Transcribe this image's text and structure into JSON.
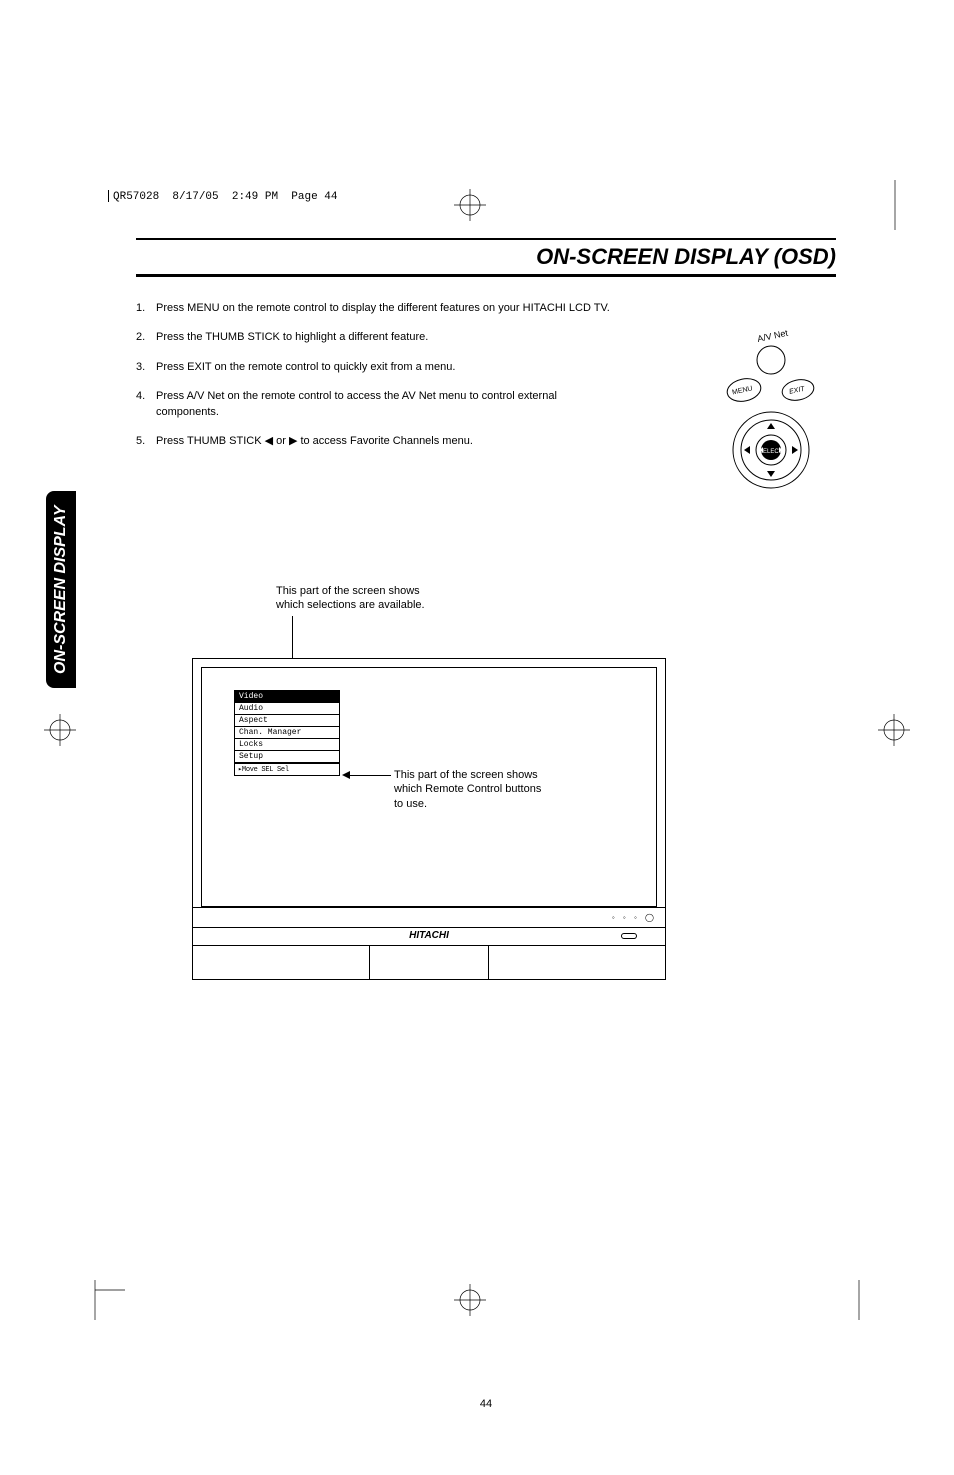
{
  "print_header": {
    "doc": "QR57028",
    "date": "8/17/05",
    "time": "2:49 PM",
    "page": "Page 44"
  },
  "title": "ON-SCREEN DISPLAY (OSD)",
  "instructions": [
    "Press MENU on the remote control to display the different features on your HITACHI LCD TV.",
    "Press the THUMB STICK to highlight a different feature.",
    "Press EXIT on the remote control to quickly exit from a menu.",
    "Press A/V Net on the remote control to access the AV Net menu to control external components.",
    "Press THUMB STICK ◀ or ▶ to access Favorite Channels menu."
  ],
  "remote": {
    "av_net": "A/V Net",
    "menu": "MENU",
    "exit": "EXIT",
    "select": "SELECT"
  },
  "caption_top": {
    "l1": "This part of the screen shows",
    "l2": "which selections are available."
  },
  "osd": {
    "items": [
      "Video",
      "Audio",
      "Aspect",
      "Chan. Manager",
      "Locks",
      "Setup"
    ],
    "hint": "▸Move  SEL Sel"
  },
  "inline_caption": {
    "l1": "This part of the screen shows",
    "l2": "which Remote Control buttons",
    "l3": "to use."
  },
  "tv_logo": "HITACHI",
  "ctrl_dots": "◦ ◦ ◦ ◯",
  "side_tab": "ON-SCREEN DISPLAY",
  "page_number": "44"
}
